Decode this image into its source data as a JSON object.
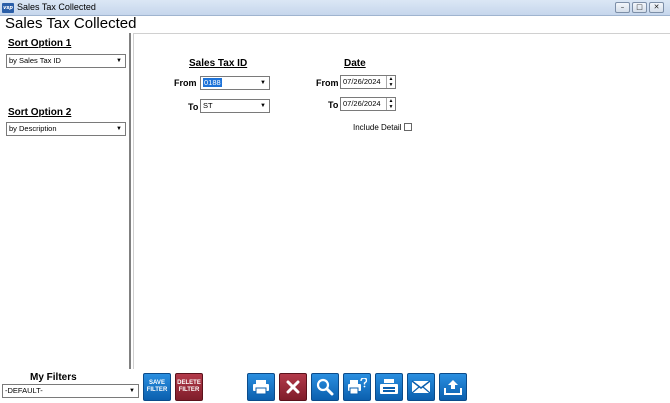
{
  "window": {
    "title": "Sales Tax Collected",
    "heading": "Sales Tax Collected"
  },
  "sort": {
    "option1_label": "Sort Option 1",
    "option1_value": "by Sales Tax ID",
    "option2_label": "Sort Option 2",
    "option2_value": "by Description"
  },
  "filters": {
    "sales_tax_id_title": "Sales Tax ID",
    "date_title": "Date",
    "from_label": "From",
    "to_label": "To",
    "tax_from": "0188",
    "tax_to": "ST",
    "date_from": "07/26/2024",
    "date_to": "07/26/2024",
    "include_detail_label": "Include Detail"
  },
  "my_filters": {
    "label": "My Filters",
    "selected": "-DEFAULT-"
  },
  "buttons": {
    "save_line1": "SAVE",
    "save_line2": "FILTER",
    "delete_line1": "DELETE",
    "delete_line2": "FILTER"
  }
}
